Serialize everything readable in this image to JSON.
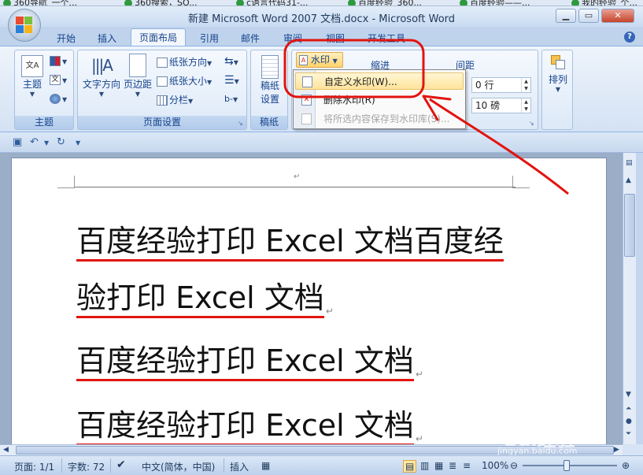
{
  "browser_tabs": [
    "360导航_一个...",
    "360搜索，SO...",
    "c语言代码31-...",
    "百度经验_360...",
    "百度经验——...",
    "我的经验_个..."
  ],
  "window": {
    "title": "新建 Microsoft Word 2007 文档.docx - Microsoft Word",
    "minimize": "▁",
    "maximize": "▭",
    "close": "✕"
  },
  "ribbon_tabs": [
    {
      "label": "开始"
    },
    {
      "label": "插入"
    },
    {
      "label": "页面布局"
    },
    {
      "label": "引用"
    },
    {
      "label": "邮件"
    },
    {
      "label": "审阅"
    },
    {
      "label": "视图"
    },
    {
      "label": "开发工具"
    }
  ],
  "active_tab": "页面布局",
  "groups": {
    "theme": {
      "label": "主题",
      "theme_btn": "主题",
      "theme_icon_text": "文A"
    },
    "page_setup": {
      "label": "页面设置",
      "text_direction": "文字方向",
      "margins": "页边距",
      "orientation": "纸张方向",
      "size": "纸张大小",
      "columns": "分栏"
    },
    "draft": {
      "label": "稿纸",
      "btn_line1": "稿纸",
      "btn_line2": "设置"
    },
    "paragraph": {
      "indent_label": "缩进",
      "spacing_label": "间距",
      "before_value": "0 行",
      "after_value": "10 磅"
    },
    "arrange": {
      "label": "排列"
    }
  },
  "watermark": {
    "button_label": "水印",
    "menu_items": [
      {
        "label": "自定义水印(W)...",
        "state": "hover"
      },
      {
        "label": "删除水印(R)",
        "state": "normal"
      },
      {
        "label": "将所选内容保存到水印库(S)...",
        "state": "disabled"
      }
    ]
  },
  "document": {
    "header_mark": "↵",
    "paragraphs": [
      {
        "text": "百度经验打印 Excel 文档百度经",
        "mark": ""
      },
      {
        "text": "验打印 Excel 文档",
        "mark": "↵"
      },
      {
        "text": "百度经验打印 Excel 文档",
        "mark": "↵"
      },
      {
        "text": "百度经验打印 Excel 文档",
        "mark": "↵"
      }
    ]
  },
  "statusbar": {
    "page": "页面: 1/1",
    "words": "字数: 72",
    "language": "中文(简体，中国)",
    "mode": "插入",
    "zoom": "100%",
    "zoom_minus": "⊖",
    "zoom_plus": "⊕"
  },
  "overlay": {
    "watermark_brand": "Bai经验",
    "watermark_url": "jingyan.baidu.com"
  },
  "colors": {
    "annotation_red": "#e2140e",
    "ribbon_blue": "#15428b"
  }
}
